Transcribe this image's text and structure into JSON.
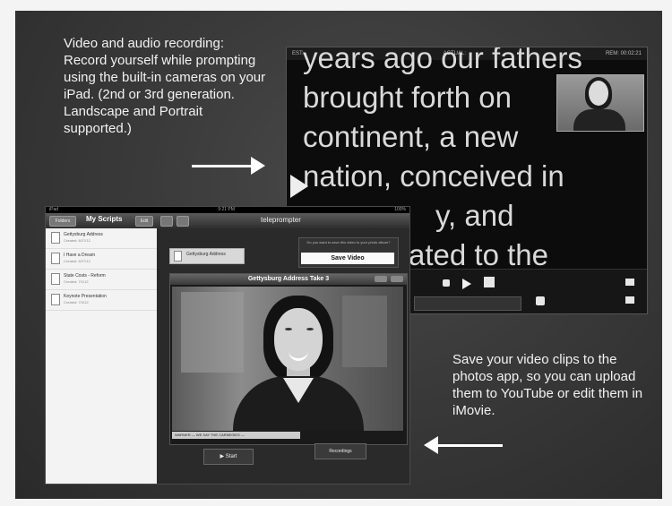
{
  "captions": {
    "top": "Video and audio recording: Record yourself while prompting using the built-in cameras on your iPad. (2nd or 3rd generation. Landscape and Portrait supported.)",
    "bottom": "Save your video clips to the photos app, so you can upload them to YouTube or edit them in iMovie."
  },
  "prompter": {
    "status_left": "EST:",
    "status_center": "ACTUAL:",
    "status_right": "REM: 00:02:21",
    "lines": [
      "years ago our fathers",
      "brought forth on",
      "continent, a new",
      "nation, conceived in",
      "y, and",
      "ated to the"
    ]
  },
  "ipad": {
    "status_left": "iPad",
    "status_center": "9:21 PM",
    "status_right": "100%",
    "nav_title": "My Scripts",
    "nav_left_btn": "Folders",
    "nav_edit": "Edit",
    "nav_logo": "teleprompter",
    "scripts": [
      {
        "title": "Gettysburg Address",
        "sub": "Created: 6/27/12"
      },
      {
        "title": "I Have a Dream",
        "sub": "Created: 6/27/12"
      },
      {
        "title": "State Costs - Reform",
        "sub": "Created: 7/1/12"
      },
      {
        "title": "Keynote Presentation",
        "sub": "Created: 7/3/12"
      }
    ],
    "doc_card": "Gettysburg Address",
    "save_hint": "Do you want to save this video to your photo album?",
    "save_button": "Save Video",
    "take_title": "Gettysburg Address Take 3",
    "subtitle": "WARNER — WE SAY THE CARNEGIES —",
    "start_button": "▶ Start",
    "recordings_button": "Recordings"
  }
}
